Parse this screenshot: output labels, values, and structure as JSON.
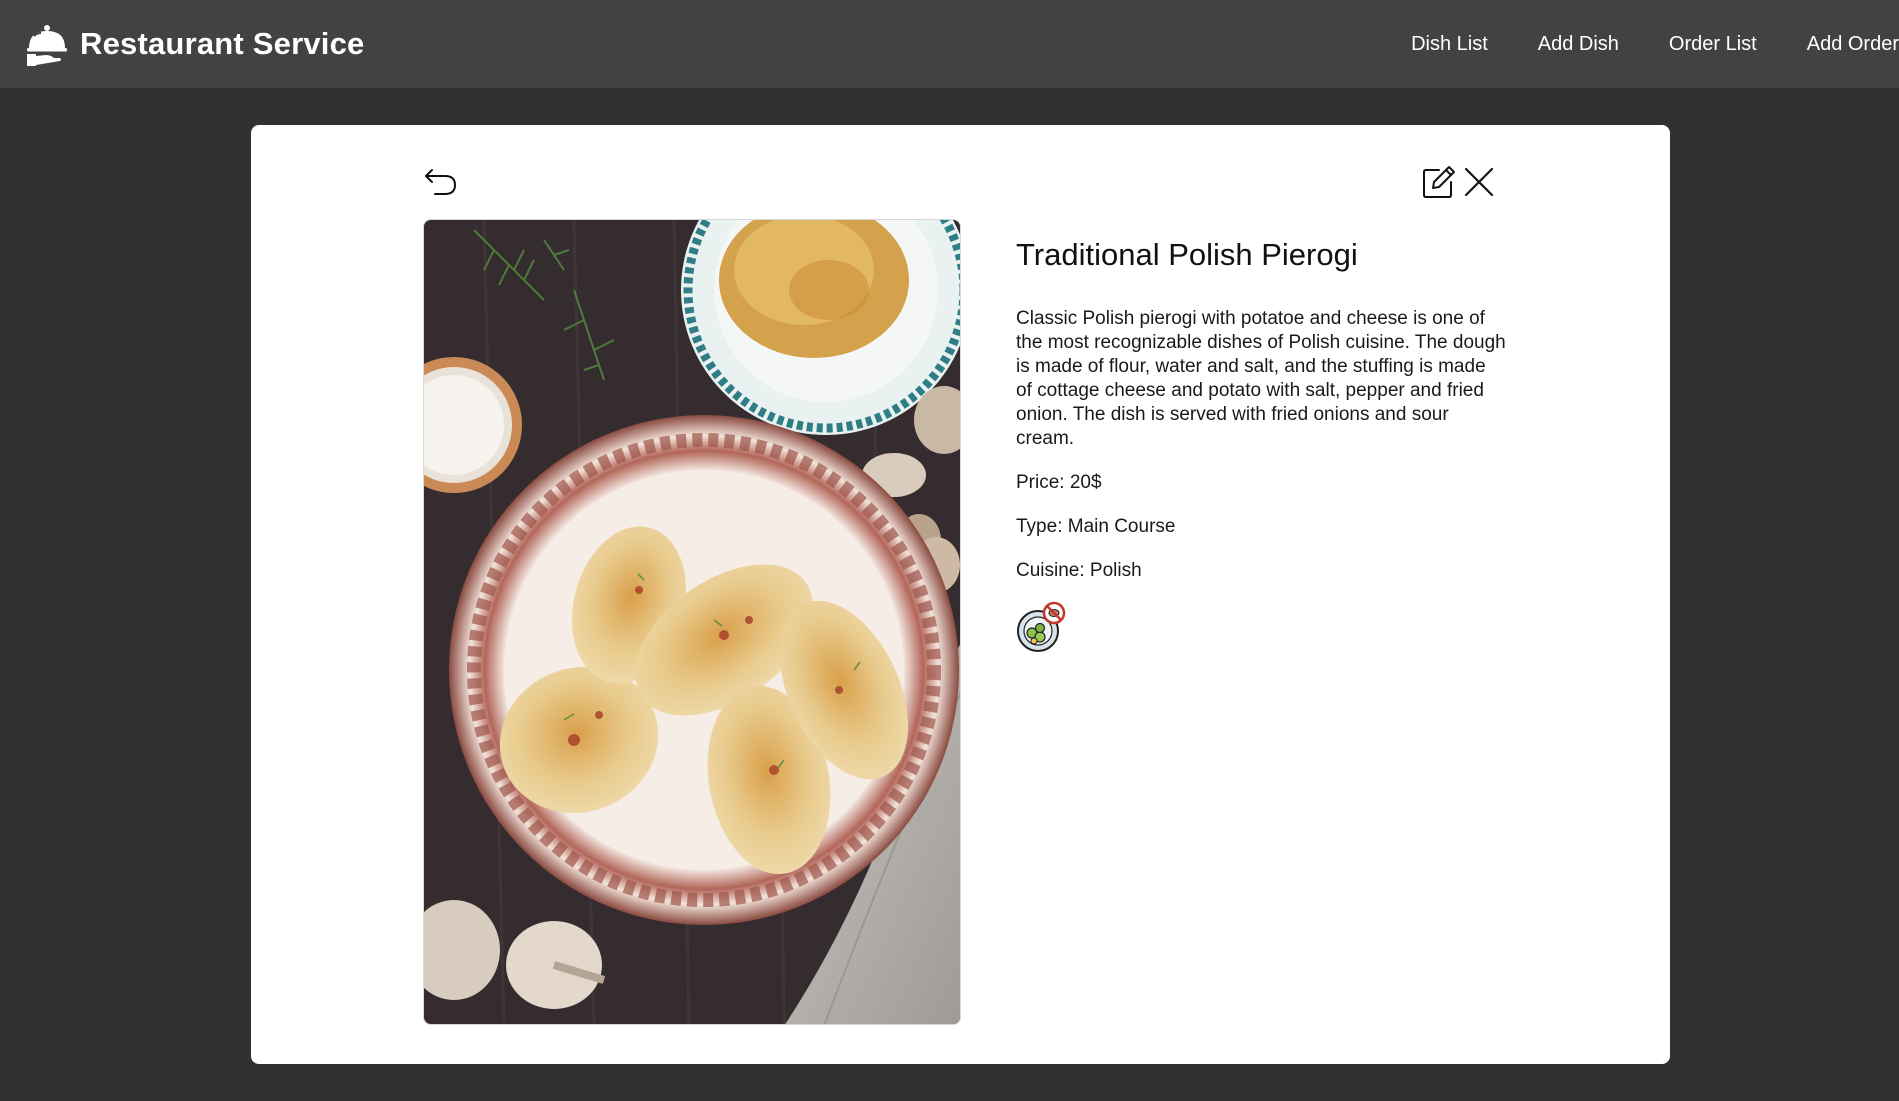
{
  "header": {
    "title": "Restaurant Service",
    "nav": [
      "Dish List",
      "Add Dish",
      "Order List",
      "Add Order"
    ]
  },
  "dish": {
    "name": "Traditional Polish Pierogi",
    "description": "Classic Polish pierogi with potatoe and cheese is one of the most recognizable dishes of Polish cuisine. The dough is made of flour, water and salt, and the stuffing is made of cottage cheese and potato with salt, pepper and fried onion. The dish is served with fried onions and sour cream.",
    "price_label": "Price: ",
    "price": "20$",
    "type_label": "Type: ",
    "type": "Main Course",
    "cuisine_label": "Cuisine: ",
    "cuisine": "Polish",
    "diet_icon": "no-meat-vegetarian-icon"
  },
  "colors": {
    "page_bg": "#313131",
    "navbar_bg": "#424242",
    "card_bg": "#ffffff",
    "text": "#1a1a1a"
  }
}
